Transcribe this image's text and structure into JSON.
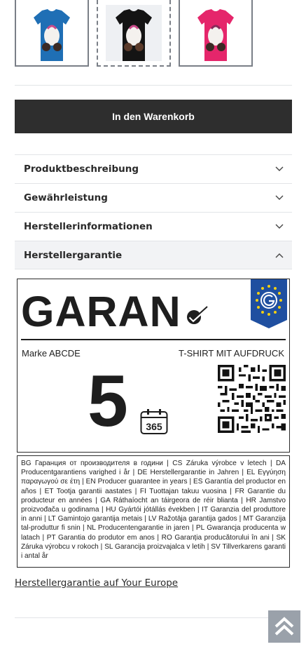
{
  "thumbnails": [
    {
      "name": "thumbnail-blue-shirt",
      "color": "#1f6fb5",
      "active": false
    },
    {
      "name": "thumbnail-black-shirt",
      "color": "#141414",
      "active": true
    },
    {
      "name": "thumbnail-pink-shirt",
      "color": "#e5266b",
      "active": false
    }
  ],
  "cart": {
    "label": "In den Warenkorb"
  },
  "accordion": [
    {
      "label": "Produktbeschreibung",
      "open": false
    },
    {
      "label": "Gewährleistung",
      "open": false
    },
    {
      "label": "Herstellerinformationen",
      "open": false
    },
    {
      "label": "Herstellergarantie",
      "open": true
    }
  ],
  "guarantee": {
    "heading": "GARAN",
    "brand": "Marke ABCDE",
    "product": "T-SHIRT MIT AUFDRUCK",
    "years": "5",
    "calendar_days": "365",
    "languages_text": "BG Гаранция от производителя в години | CS Záruka výrobce v letech | DA Producentgarantiens varighed i år | DE Herstellergarantie in Jahren | EL Εγγύηση παραγωγού σε έτη | EN Producer guarantee in years | ES Garantía del productor en años | ET Tootja garantii aastates | FI Tuottajan takuu vuosina | FR Garantie du producteur en années | GA Ráthaíocht an táirgeora de réir blianta | HR Jamstvo proizvođača u godinama | HU Gyártói jótállás években | IT Garanzia del produttore in anni | LT Gamintojo garantija metais | LV Ražotāja garantija gados | MT Garanzija tal-produttur fi snin | NL Producentengarantie in jaren | PL Gwarancja producenta w latach | PT Garantia do produtor em anos | RO Garanția producătorului în ani | SK Záruka výrobcu v rokoch | SL Garancija proizvajalca v letih | SV Tillverkarens garanti i antal år"
  },
  "eu_link": {
    "label": "Herstellergarantie auf Your Europe"
  },
  "colors": {
    "button_dark": "#2e2e2e",
    "scroll_button": "#9aa1aa",
    "eu_blue": "#1f4fa0",
    "eu_yellow": "#f5d010"
  }
}
